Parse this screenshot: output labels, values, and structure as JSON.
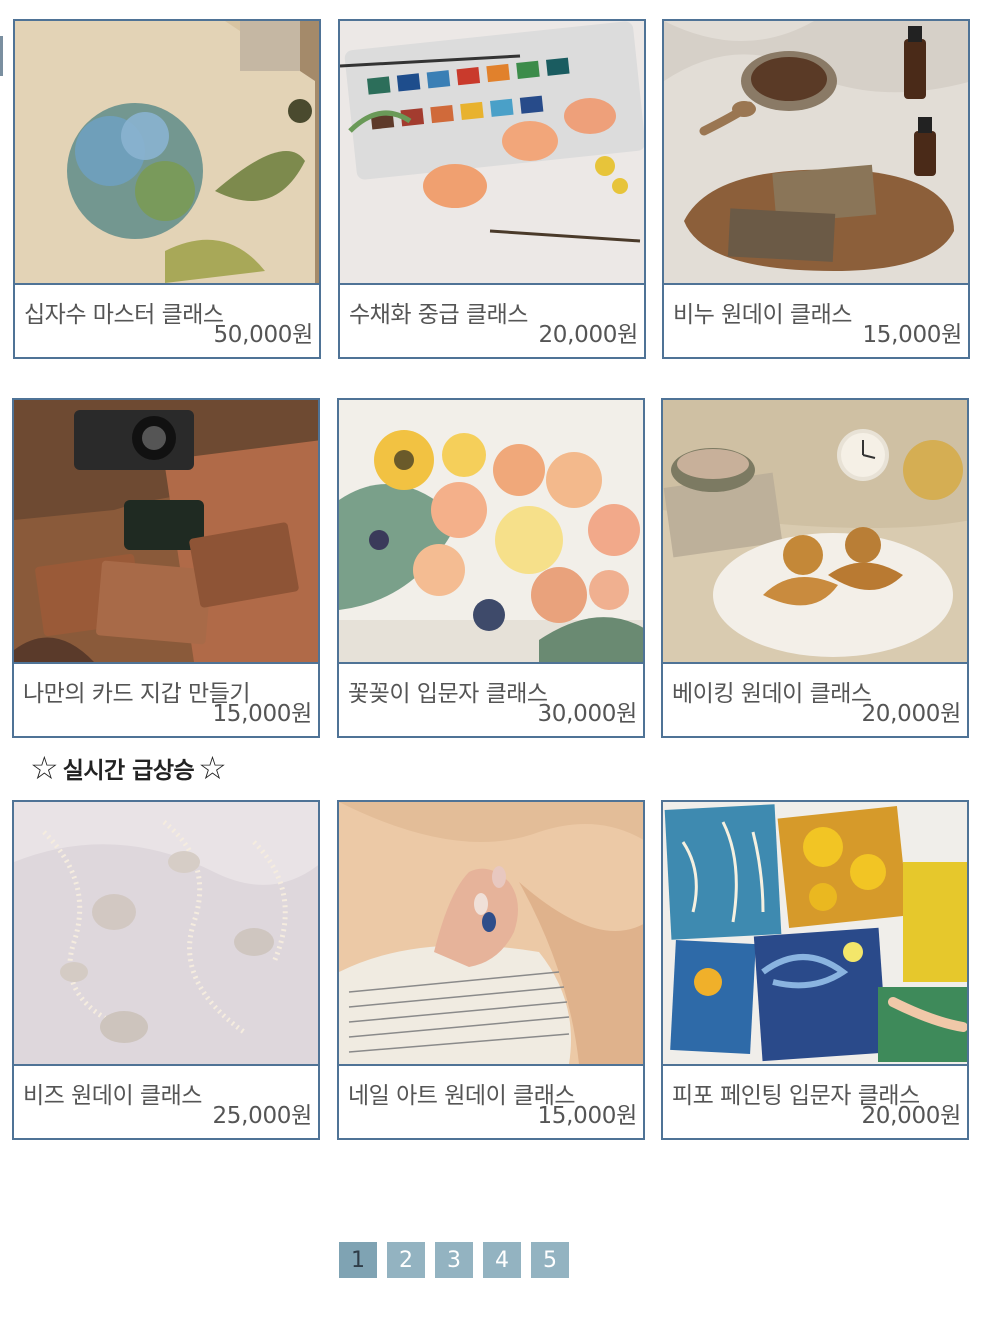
{
  "cards": [
    {
      "title": "십자수 마스터 클래스",
      "price": "50,000원",
      "image": "cross-stitch-hydrangea"
    },
    {
      "title": "수채화 중급 클래스",
      "price": "20,000원",
      "image": "watercolor-palette"
    },
    {
      "title": "비누 원데이 클래스",
      "price": "15,000원",
      "image": "handmade-soap"
    },
    {
      "title": "나만의 카드 지갑 만들기",
      "price": "15,000원",
      "image": "leather-wallets"
    },
    {
      "title": "꽃꽂이 입문자 클래스",
      "price": "30,000원",
      "image": "flower-bouquet"
    },
    {
      "title": "베이킹 원데이 클래스",
      "price": "20,000원",
      "image": "croissant-baking"
    }
  ],
  "trending": {
    "heading": "실시간 급상승",
    "star_icon": "star-outline-icon",
    "cards": [
      {
        "title": "비즈 원데이 클래스",
        "price": "25,000원",
        "image": "pearl-beads"
      },
      {
        "title": "네일 아트 원데이 클래스",
        "price": "15,000원",
        "image": "nail-art-hand"
      },
      {
        "title": "피포 페인팅 입문자 클래스",
        "price": "20,000원",
        "image": "paint-by-number"
      }
    ]
  },
  "pagination": {
    "pages": [
      "1",
      "2",
      "3",
      "4",
      "5"
    ],
    "current": "1"
  },
  "colors": {
    "card_border": "#4f7396",
    "pager_bg": "#93b3c1",
    "pager_active": "#7fa3b3"
  }
}
